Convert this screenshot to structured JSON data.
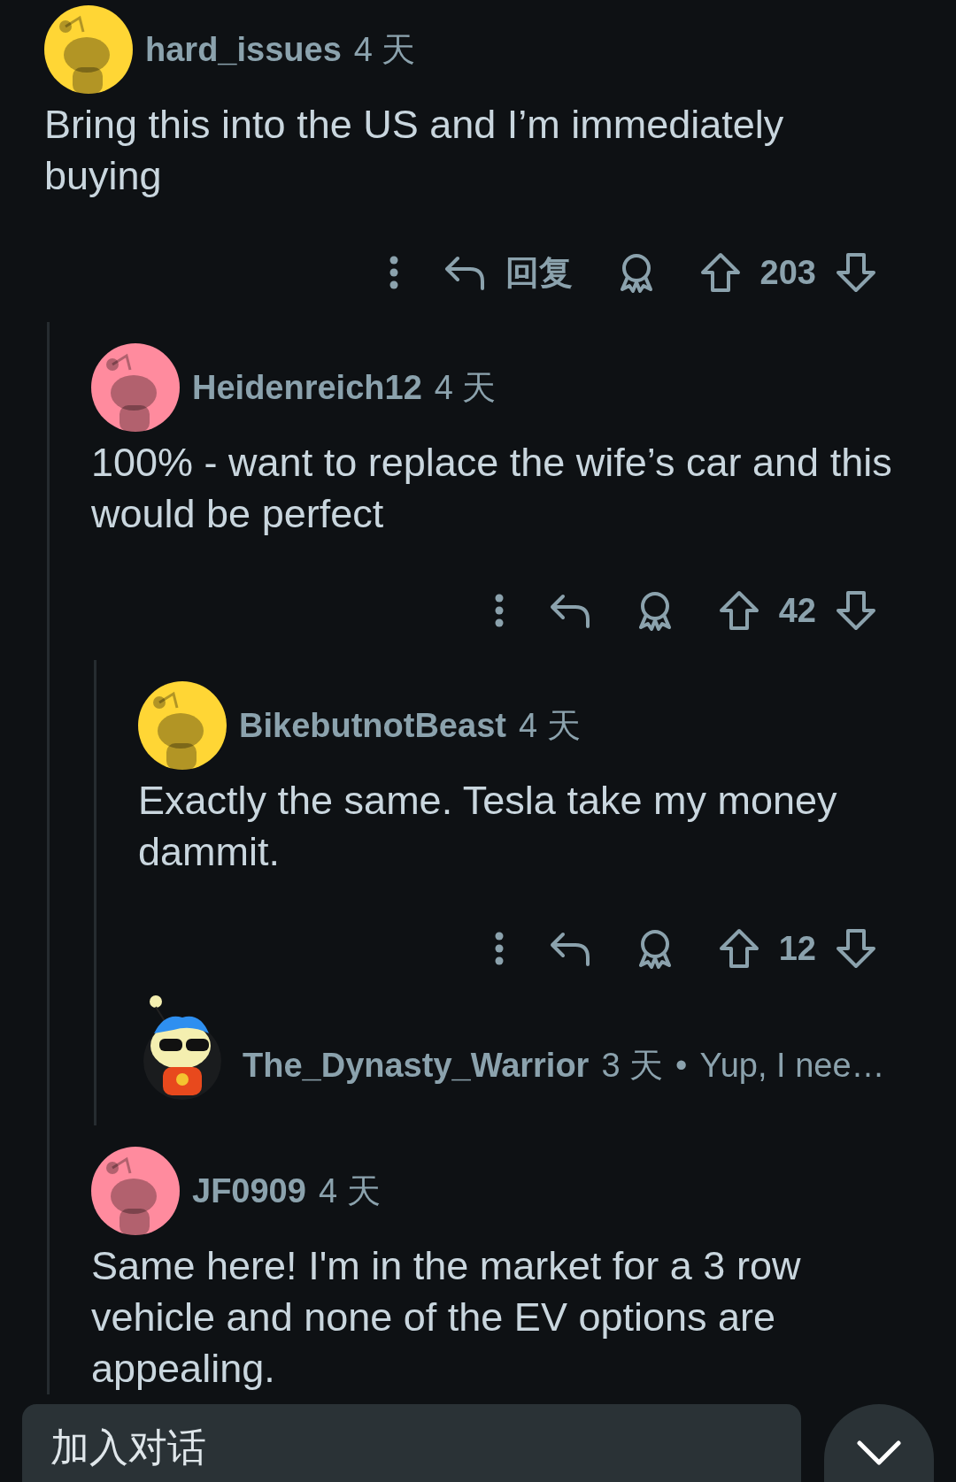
{
  "comments": [
    {
      "kind": "full",
      "author": "hard_issues",
      "age": "4 天",
      "color": "#ffd635",
      "body": "Bring this into the US and I’m immediately buying",
      "reply_label": "回复",
      "score": "203",
      "children": [
        {
          "kind": "full",
          "author": "Heidenreich12",
          "age": "4 天",
          "color": "#ff8b9e",
          "body": "100% - want to replace the wife’s car and this would be perfect",
          "score": "42",
          "children": [
            {
              "kind": "full",
              "author": "BikebutnotBeast",
              "age": "4 天",
              "color": "#ffd635",
              "body": "Exactly the same. Tesla take my money dammit.",
              "score": "12"
            },
            {
              "kind": "collapsed",
              "author": "The_Dynasty_Warrior",
              "age": "3 天",
              "separator": "•",
              "preview": "Yup, I nee…"
            }
          ]
        },
        {
          "kind": "full",
          "author": "JF0909",
          "age": "4 天",
          "color": "#ff8b9e",
          "body": "Same here! I'm in the market for a 3 row vehicle and none of the EV options are appealing."
        }
      ]
    }
  ],
  "composer": {
    "placeholder": "加入对话"
  }
}
